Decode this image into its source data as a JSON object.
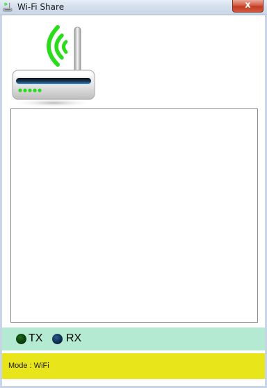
{
  "window": {
    "title": "Wi-Fi Share",
    "close_label": "x"
  },
  "status": {
    "tx_label": "TX",
    "rx_label": "RX"
  },
  "mode_bar": {
    "text": "Mode : WiFi"
  },
  "icons": {
    "app": "wifi-router-icon",
    "router": "router-icon",
    "close": "close-icon"
  },
  "colors": {
    "status_strip": "#b3ead1",
    "mode_bar": "#e8e61a",
    "wifi_waves": "#2bdc1d",
    "tx_led": "#0b3a0b",
    "rx_led": "#0e2a4e",
    "close_button": "#c9452b"
  }
}
